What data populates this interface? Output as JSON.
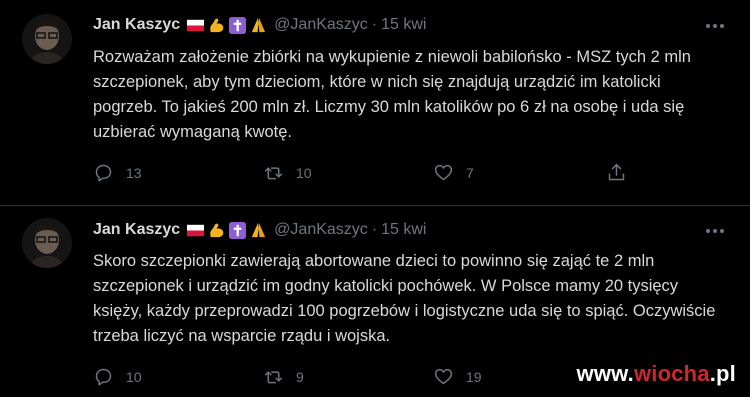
{
  "tweets": [
    {
      "author": "Jan Kaszyc",
      "handle": "@JanKaszyc",
      "separator": "·",
      "time": "15 kwi",
      "emojis": [
        "poland-flag-icon",
        "flexed-biceps-icon",
        "latin-cross-icon",
        "folded-hands-icon"
      ],
      "text": "Rozważam założenie zbiórki na wykupienie z niewoli babilońsko - MSZ tych 2 mln szczepionek, aby tym dzieciom, które w nich się znajdują urządzić im katolicki pogrzeb. To jakieś 200 mln zł. Liczmy 30 mln katolików po 6 zł na osobę i uda się uzbierać wymaganą kwotę.",
      "replies": "13",
      "retweets": "10",
      "likes": "7"
    },
    {
      "author": "Jan Kaszyc",
      "handle": "@JanKaszyc",
      "separator": "·",
      "time": "15 kwi",
      "emojis": [
        "poland-flag-icon",
        "flexed-biceps-icon",
        "latin-cross-icon",
        "folded-hands-icon"
      ],
      "text": "Skoro szczepionki zawierają abortowane dzieci to powinno się zająć te 2 mln szczepionek i urządzić im godny katolicki pochówek. W Polsce mamy 20 tysięcy księży, każdy przeprowadzi 100 pogrzebów i logistyczne uda się to spiąć. Oczywiście trzeba liczyć na wsparcie rządu i wojska.",
      "replies": "10",
      "retweets": "9",
      "likes": "19"
    }
  ],
  "watermark": {
    "main": "www.",
    "brand": "wiocha",
    "suffix": ".pl"
  },
  "colors": {
    "background": "#000000",
    "text": "#d9d9d9",
    "muted": "#6e767d",
    "divider": "#2f3336",
    "watermark_accent": "#d0262c"
  }
}
